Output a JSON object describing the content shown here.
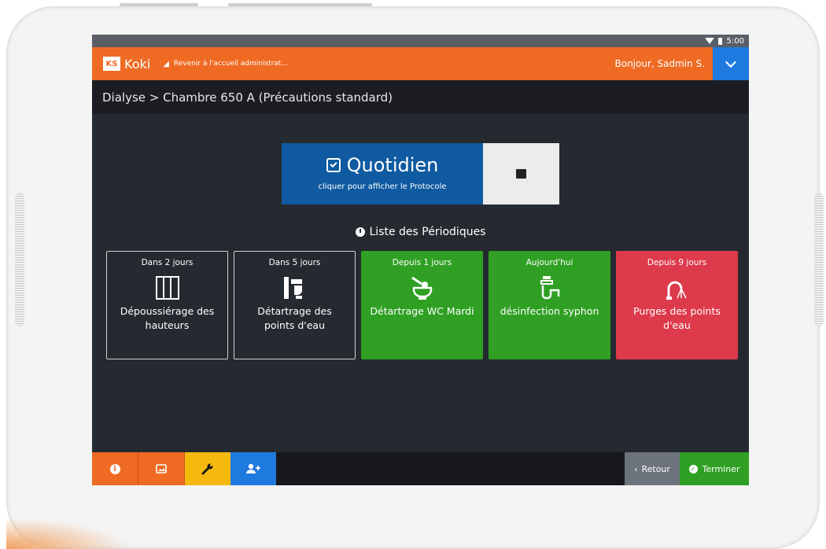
{
  "status_bar": {
    "time": "5:00"
  },
  "header": {
    "logo_text": "KS",
    "app_name": "Koki",
    "back_admin_label": "Revenir à l'accueil administrat...",
    "greeting": "Bonjour, Sadmin S."
  },
  "breadcrumb": "Dialyse > Chambre 650 A  (Précautions standard)",
  "protocol": {
    "title": "Quotidien",
    "subtitle": "cliquer pour afficher le Protocole"
  },
  "periodics": {
    "heading": "Liste des Périodiques",
    "items": [
      {
        "when": "Dans 2 jours",
        "label": "Dépoussiérage des hauteurs",
        "status": "upcoming",
        "icon": "cabinet-icon"
      },
      {
        "when": "Dans 5 jours",
        "label": "Détartrage des points d'eau",
        "status": "upcoming",
        "icon": "sink-cleaning-icon"
      },
      {
        "when": "Depuis 1 jours",
        "label": "Détartrage WC Mardi",
        "status": "due",
        "icon": "toilet-cleaning-icon"
      },
      {
        "when": "Aujourd'hui",
        "label": "désinfection syphon",
        "status": "due",
        "icon": "siphon-icon"
      },
      {
        "when": "Depuis 9 jours",
        "label": "Purges des points d'eau",
        "status": "overdue",
        "icon": "faucet-icon"
      }
    ]
  },
  "footer": {
    "retour_label": "Retour",
    "terminer_label": "Terminer"
  },
  "colors": {
    "accent_orange": "#ef6a23",
    "blue": "#0f5aa0",
    "green": "#2fa023",
    "red": "#dd3a4b",
    "background": "#252a31"
  }
}
